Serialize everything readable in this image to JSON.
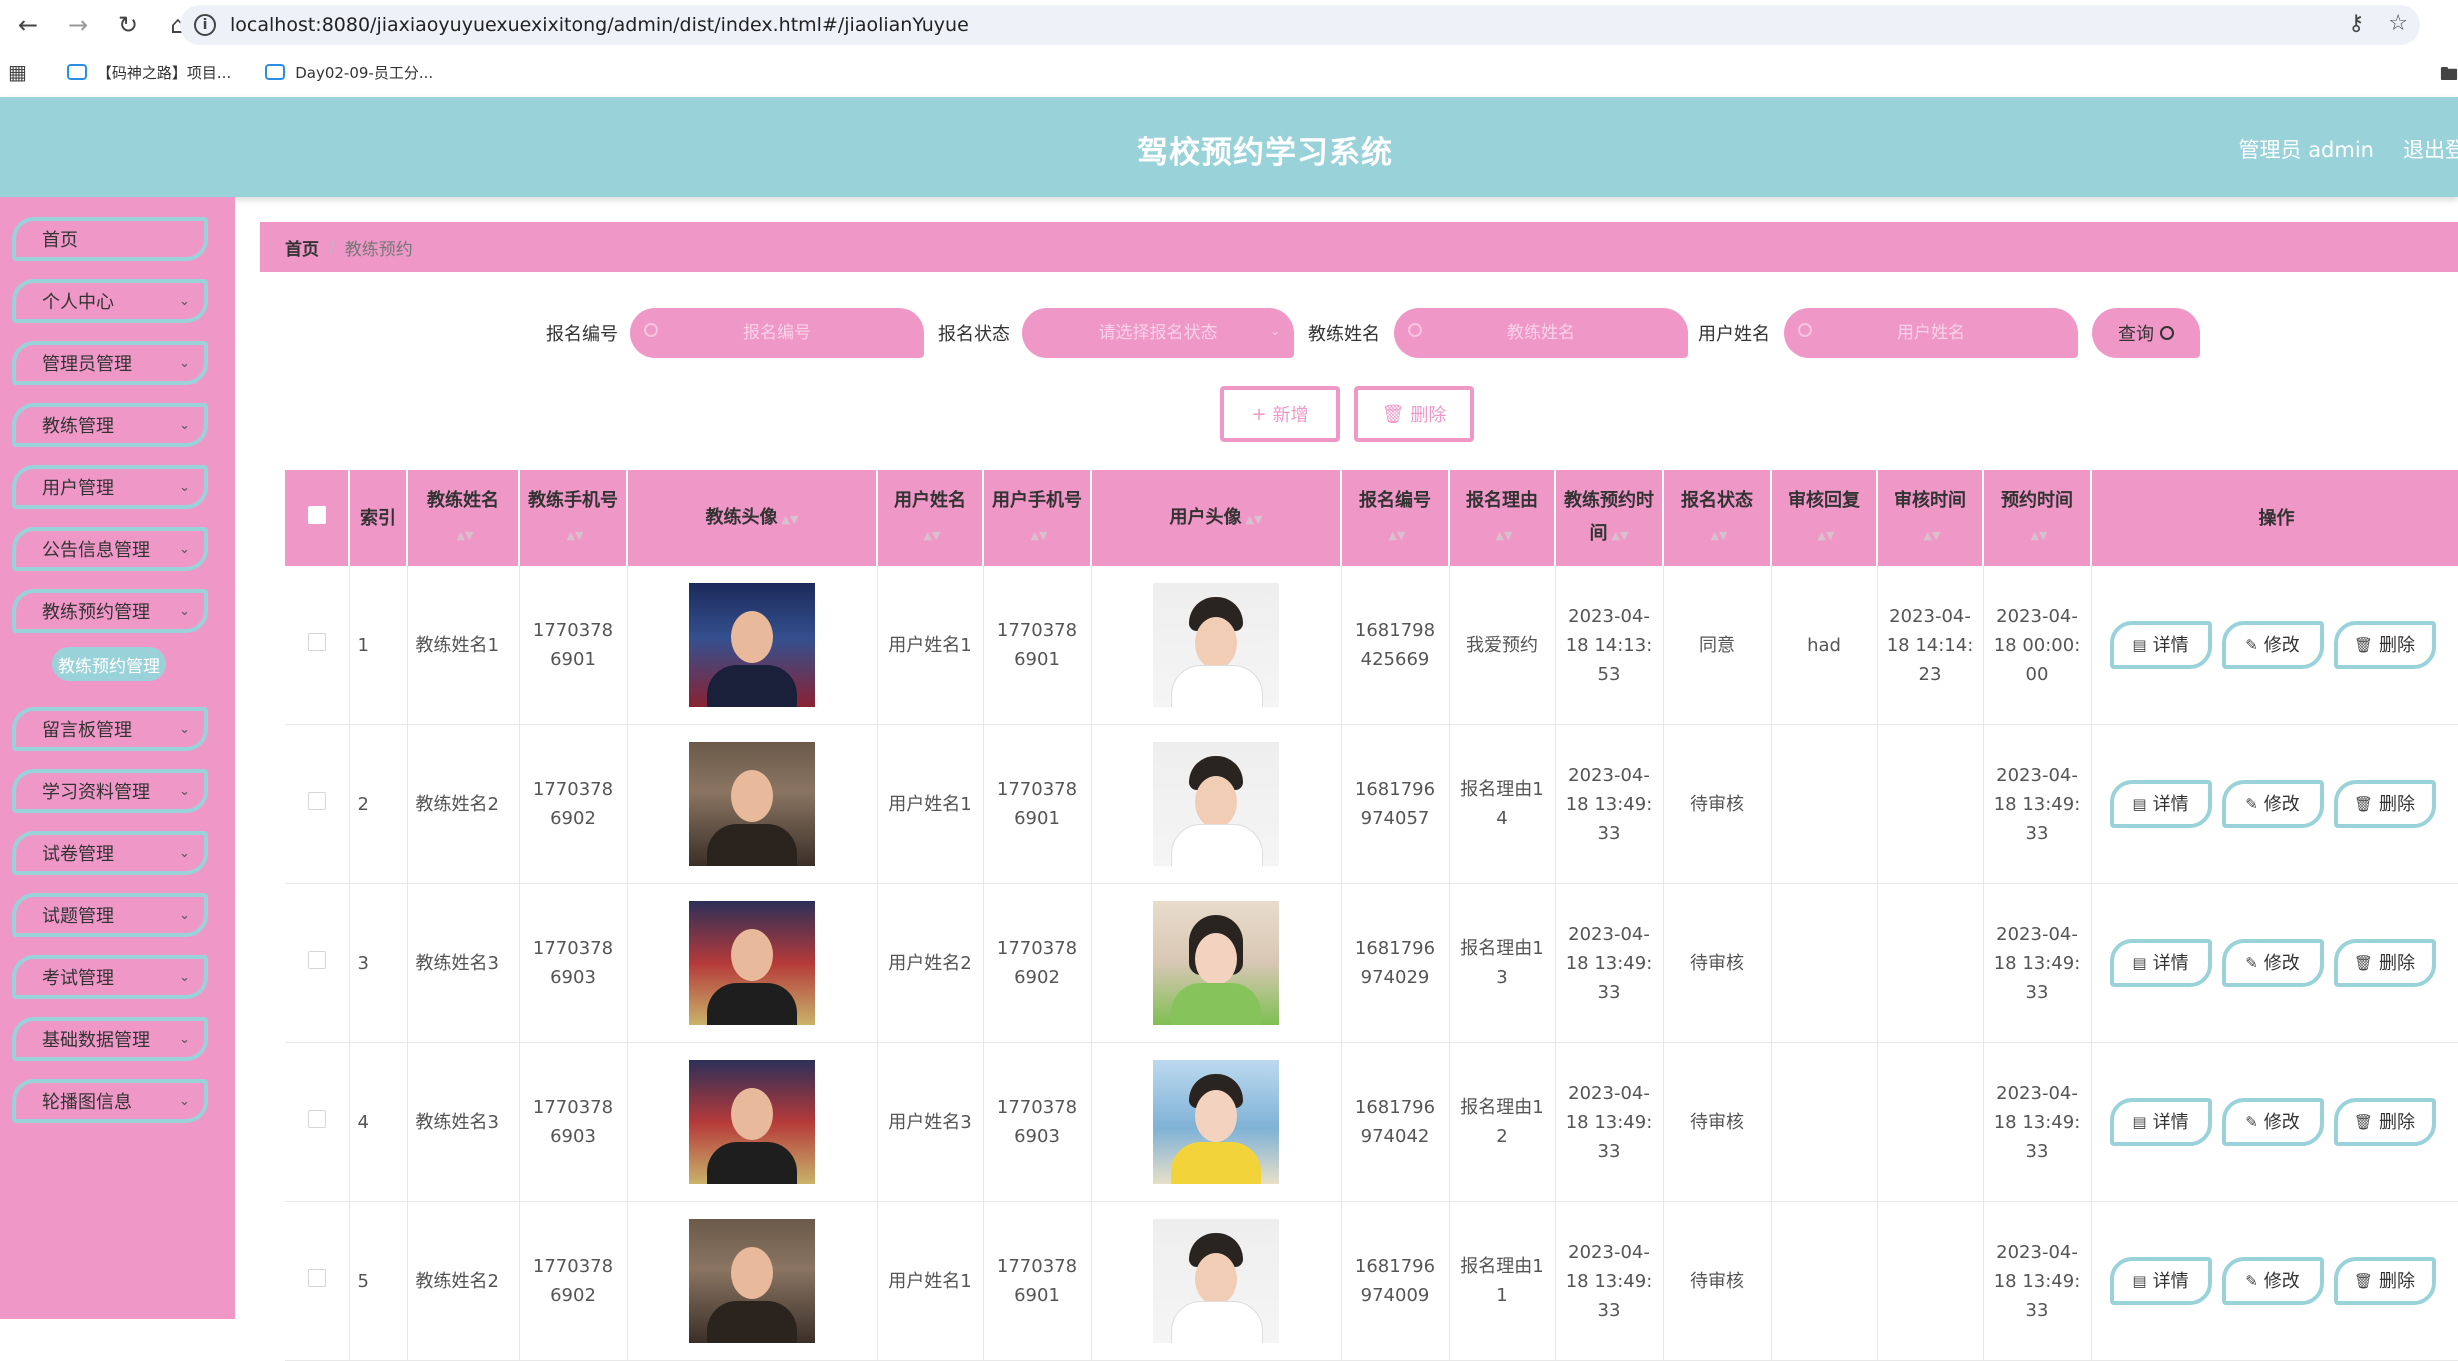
{
  "browser": {
    "url": "localhost:8080/jiaxiaoyuyuexuexixitong/admin/dist/index.html#/jiaolianYuyue",
    "bookmarks": [
      "【码神之路】项目...",
      "Day02-09-员工分..."
    ]
  },
  "header": {
    "title": "驾校预约学习系统",
    "user": "管理员 admin",
    "logout": "退出登"
  },
  "sidebar": {
    "items": [
      {
        "label": "首页"
      },
      {
        "label": "个人中心"
      },
      {
        "label": "管理员管理"
      },
      {
        "label": "教练管理"
      },
      {
        "label": "用户管理"
      },
      {
        "label": "公告信息管理"
      },
      {
        "label": "教练预约管理"
      },
      {
        "label": "留言板管理"
      },
      {
        "label": "学习资料管理"
      },
      {
        "label": "试卷管理"
      },
      {
        "label": "试题管理"
      },
      {
        "label": "考试管理"
      },
      {
        "label": "基础数据管理"
      },
      {
        "label": "轮播图信息"
      }
    ],
    "active_sub": "教练预约管理"
  },
  "breadcrumb": {
    "home": "首页",
    "separator": "/",
    "current": "教练预约"
  },
  "search": {
    "fields": [
      {
        "label": "报名编号",
        "placeholder": "报名编号"
      },
      {
        "label": "报名状态",
        "placeholder": "请选择报名状态"
      },
      {
        "label": "教练姓名",
        "placeholder": "教练姓名"
      },
      {
        "label": "用户姓名",
        "placeholder": "用户姓名"
      }
    ],
    "query_label": "查询"
  },
  "actions": {
    "add_label": "新增",
    "delete_label": "删除"
  },
  "table": {
    "columns": {
      "index": "索引",
      "coach_name": "教练姓名",
      "coach_phone": "教练手机号",
      "coach_avatar": "教练头像",
      "user_name": "用户姓名",
      "user_phone": "用户手机号",
      "user_avatar": "用户头像",
      "signup_no": "报名编号",
      "reason": "报名理由",
      "appoint_time": "教练预约时间",
      "status": "报名状态",
      "review_reply": "审核回复",
      "review_time": "审核时间",
      "booking_time": "预约时间",
      "ops": "操作"
    },
    "op_labels": {
      "detail": "详情",
      "edit": "修改",
      "delete": "删除"
    },
    "rows": [
      {
        "index": "1",
        "coach_name": "教练姓名1",
        "coach_phone": "17703786901",
        "user_name": "用户姓名1",
        "user_phone": "17703786901",
        "signup_no": "1681798425669",
        "reason": "我爱预约",
        "appoint_time": "2023-04-18 14:13:53",
        "status": "同意",
        "review_reply": "had",
        "review_time": "2023-04-18 14:14:23",
        "booking_time": "2023-04-18 00:00:00"
      },
      {
        "index": "2",
        "coach_name": "教练姓名2",
        "coach_phone": "17703786902",
        "user_name": "用户姓名1",
        "user_phone": "17703786901",
        "signup_no": "1681796974057",
        "reason": "报名理由14",
        "appoint_time": "2023-04-18 13:49:33",
        "status": "待审核",
        "review_reply": "",
        "review_time": "",
        "booking_time": "2023-04-18 13:49:33"
      },
      {
        "index": "3",
        "coach_name": "教练姓名3",
        "coach_phone": "17703786903",
        "user_name": "用户姓名2",
        "user_phone": "17703786902",
        "signup_no": "1681796974029",
        "reason": "报名理由13",
        "appoint_time": "2023-04-18 13:49:33",
        "status": "待审核",
        "review_reply": "",
        "review_time": "",
        "booking_time": "2023-04-18 13:49:33"
      },
      {
        "index": "4",
        "coach_name": "教练姓名3",
        "coach_phone": "17703786903",
        "user_name": "用户姓名3",
        "user_phone": "17703786903",
        "signup_no": "1681796974042",
        "reason": "报名理由12",
        "appoint_time": "2023-04-18 13:49:33",
        "status": "待审核",
        "review_reply": "",
        "review_time": "",
        "booking_time": "2023-04-18 13:49:33"
      },
      {
        "index": "5",
        "coach_name": "教练姓名2",
        "coach_phone": "17703786902",
        "user_name": "用户姓名1",
        "user_phone": "17703786901",
        "signup_no": "1681796974009",
        "reason": "报名理由11",
        "appoint_time": "2023-04-18 13:49:33",
        "status": "待审核",
        "review_reply": "",
        "review_time": "",
        "booking_time": "2023-04-18 13:49:33"
      }
    ]
  },
  "colors": {
    "header_teal": "#9ad2d9",
    "accent_pink": "#ef98c8"
  }
}
